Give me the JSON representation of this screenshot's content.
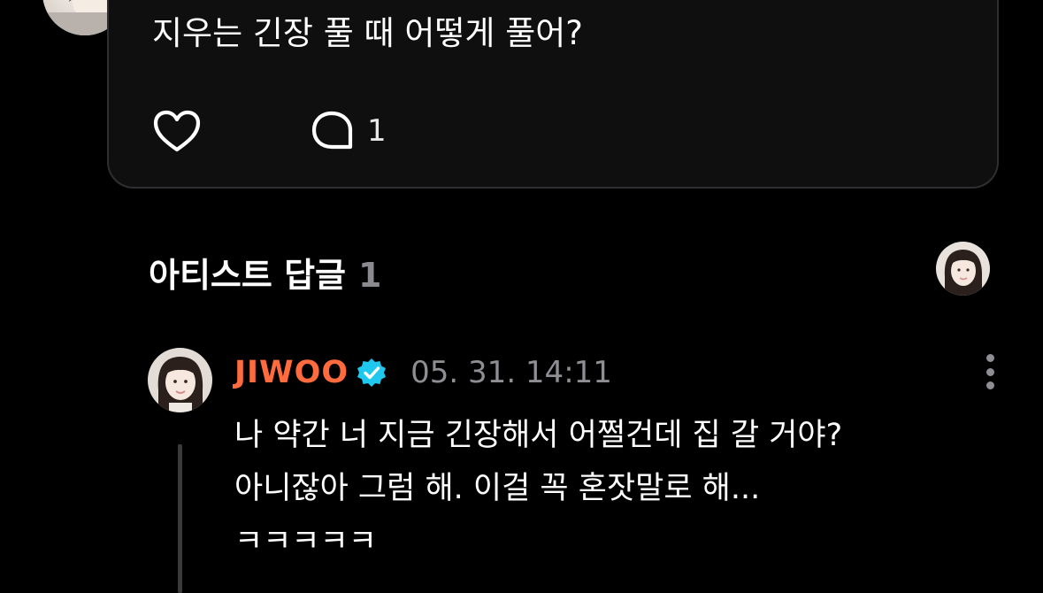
{
  "post": {
    "text": "지우는 긴장 풀 때 어떻게 풀어?",
    "like_icon": "heart-icon",
    "comment_icon": "speech-bubble-icon",
    "comment_count": "1"
  },
  "artist_replies": {
    "title": "아티스트 답글",
    "count": "1"
  },
  "reply": {
    "author": "JIWOO",
    "verified_icon": "verified-badge-icon",
    "timestamp": "05. 31. 14:11",
    "lines": [
      "나 약간 너 지금 긴장해서 어쩔건데 집 갈 거야?",
      "아니잖아 그럼 해. 이걸 꼭 혼잣말로 해...",
      "ㅋㅋㅋㅋㅋ"
    ],
    "menu_icon": "more-vertical-icon"
  },
  "colors": {
    "background": "#000000",
    "card": "#0f0f10",
    "author": "#ff6b3d",
    "verified": "#1ec8ee",
    "muted": "#8e8e93"
  }
}
